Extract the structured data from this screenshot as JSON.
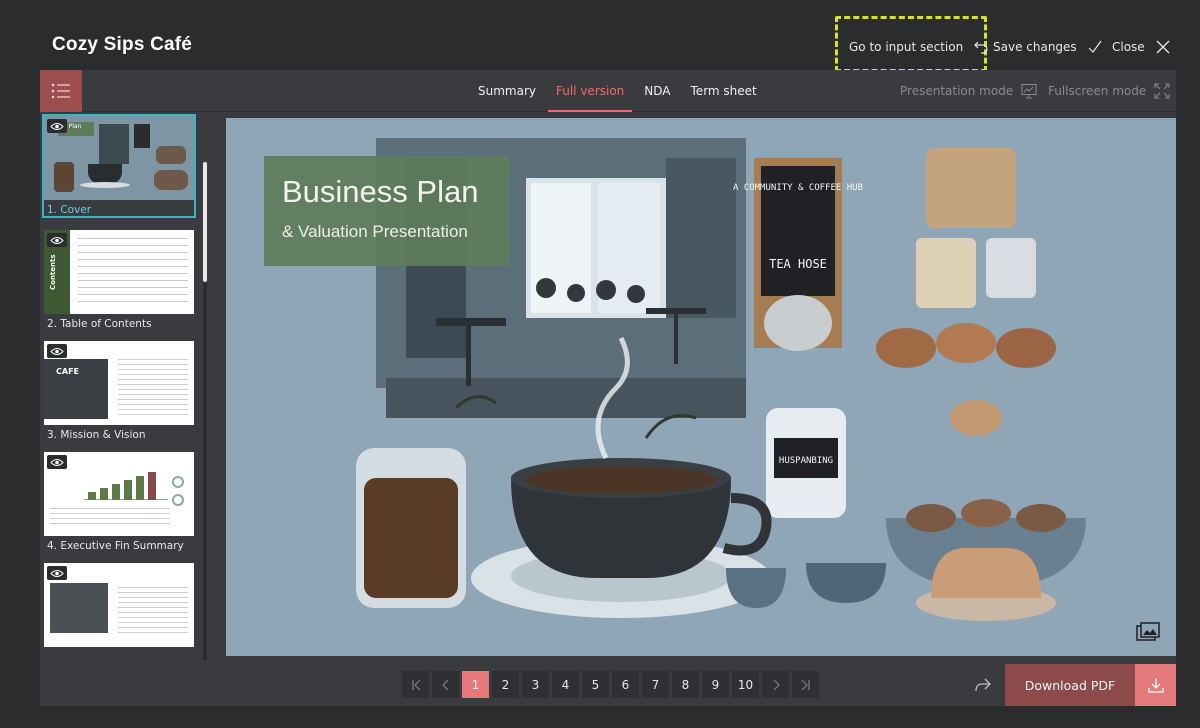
{
  "app": {
    "title": "Cozy Sips Café"
  },
  "header": {
    "go_to_input": "Go to input section",
    "save_changes": "Save changes",
    "close": "Close"
  },
  "toolbar": {
    "tabs": [
      {
        "label": "Summary",
        "active": false
      },
      {
        "label": "Full version",
        "active": true
      },
      {
        "label": "NDA",
        "active": false
      },
      {
        "label": "Term sheet",
        "active": false
      }
    ],
    "presentation_mode": "Presentation mode",
    "fullscreen_mode": "Fullscreen mode"
  },
  "sidebar": {
    "items": [
      {
        "label": "1. Cover",
        "selected": true,
        "thumb_text": "& Plan"
      },
      {
        "label": "2. Table of Contents",
        "selected": false,
        "thumb_text": "Contents"
      },
      {
        "label": "3. Mission & Vision",
        "selected": false,
        "thumb_text": "CAFE"
      },
      {
        "label": "4. Executive Fin Summary",
        "selected": false,
        "thumb_text": ""
      },
      {
        "label": "",
        "selected": false,
        "thumb_text": ""
      }
    ]
  },
  "slide": {
    "title": "Business Plan",
    "subtitle": "& Valuation Presentation",
    "sign_line1": "A COMMUNITY & COFFEE HUB",
    "sign_line2": "TEA HOSE",
    "jar_label": "HUSPANBING"
  },
  "pagination": {
    "pages": [
      "1",
      "2",
      "3",
      "4",
      "5",
      "6",
      "7",
      "8",
      "9",
      "10"
    ],
    "current_page": "1"
  },
  "footer": {
    "download": "Download PDF"
  },
  "colors": {
    "accent": "#f06a6a",
    "selected_outline": "#38b6c4",
    "highlight_box": "#d9e21a",
    "download_bg": "#8d4a4a"
  },
  "icons": [
    "undo-arrow-icon",
    "check-icon",
    "close-icon",
    "list-menu-icon",
    "presentation-chart-icon",
    "fullscreen-icon",
    "eye-icon",
    "image-icon",
    "first-page-icon",
    "prev-page-icon",
    "next-page-icon",
    "last-page-icon",
    "share-icon",
    "download-icon"
  ]
}
